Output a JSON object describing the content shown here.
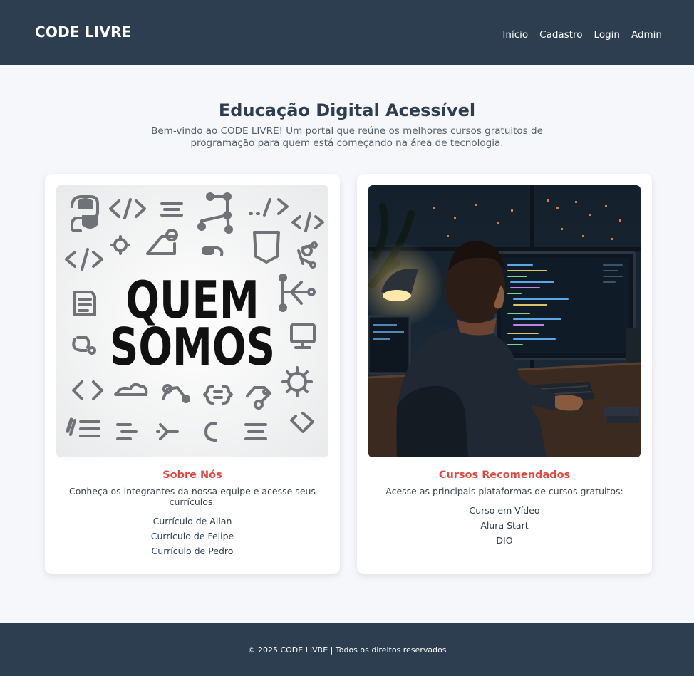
{
  "header": {
    "brand": "CODE LIVRE",
    "nav": [
      "Início",
      "Cadastro",
      "Login",
      "Admin"
    ]
  },
  "hero": {
    "title": "Educação Digital Acessível",
    "subtitle": "Bem-vindo ao CODE LIVRE! Um portal que reúne os melhores cursos gratuitos de programação para quem está começando na área de tecnologia."
  },
  "cards": [
    {
      "image_text": [
        "QUEM",
        "SOMOS"
      ],
      "title": "Sobre Nós",
      "description": "Conheça os integrantes da nossa equipe e acesse seus currículos.",
      "links": [
        "Currículo de Allan",
        "Currículo de Felipe",
        "Currículo de Pedro"
      ]
    },
    {
      "image_icon": "programmer-at-computer-illustration",
      "title": "Cursos Recomendados",
      "description": "Acesse as principais plataformas de cursos gratuitos:",
      "links": [
        "Curso em Vídeo",
        "Alura Start",
        "DIO"
      ]
    }
  ],
  "footer": {
    "text": "© 2025 CODE LIVRE | Todos os direitos reservados"
  },
  "colors": {
    "header_bg": "#2c3e50",
    "page_bg": "#f5f7fb",
    "accent": "#e0483d"
  }
}
